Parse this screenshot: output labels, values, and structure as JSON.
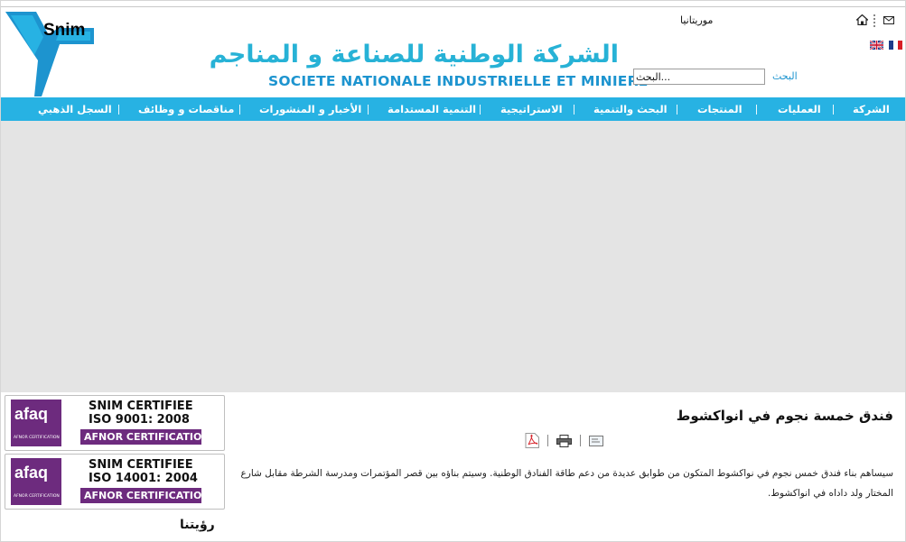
{
  "logo": {
    "text": "Snim"
  },
  "header": {
    "title_ar": "الشركة الوطنية للصناعة و المناجم",
    "title_fr": "SOCIETE NATIONALE INDUSTRIELLE ET MINIERE",
    "country": "موريتانيا",
    "icons": [
      "home-icon",
      "mail-icon",
      "flag-en",
      "flag-fr"
    ]
  },
  "search": {
    "label": "البحث",
    "value": "البحث..."
  },
  "nav": {
    "items": [
      {
        "label": "الشركة"
      },
      {
        "label": "العمليات"
      },
      {
        "label": "المنتجات"
      },
      {
        "label": "البحث والتنمية"
      },
      {
        "label": "الاستراتيجية"
      },
      {
        "label": "التنمية المستدامة"
      },
      {
        "label": "الأخبار و المنشورات"
      },
      {
        "label": "مناقصات و وظائف"
      },
      {
        "label": "السجل الذهبي"
      }
    ]
  },
  "certificates": [
    {
      "logo": "afaq",
      "logo_sub": "AFNOR CERTIFICATION",
      "line1": "SNIM CERTIFIEE",
      "line2": "ISO 9001: 2008",
      "bar": "AFNOR CERTIFICATION"
    },
    {
      "logo": "afaq",
      "logo_sub": "AFNOR CERTIFICATION",
      "line1": "SNIM CERTIFIEE",
      "line2": "ISO 14001: 2004",
      "bar": "AFNOR CERTIFICATION"
    }
  ],
  "vision": {
    "label": "رؤيتنا"
  },
  "article": {
    "title": "فندق خمسة نجوم في انواكشوط",
    "body": "سيساهم بناء فندق خمس نجوم في نواكشوط المتكون من طوابق عديدة من دعم طاقة الفنادق الوطنية. وسيتم بناؤه بين قصر المؤتمرات ومدرسة الشرطة مقابل شارع المختار ولد داداه في انواكشوط.",
    "tools": [
      "pdf-icon",
      "print-icon",
      "email-icon"
    ]
  },
  "colors": {
    "nav": "#27b2e3",
    "title": "#27b2d6",
    "cert": "#6d2b7e",
    "banner": "#e4e4e4"
  }
}
